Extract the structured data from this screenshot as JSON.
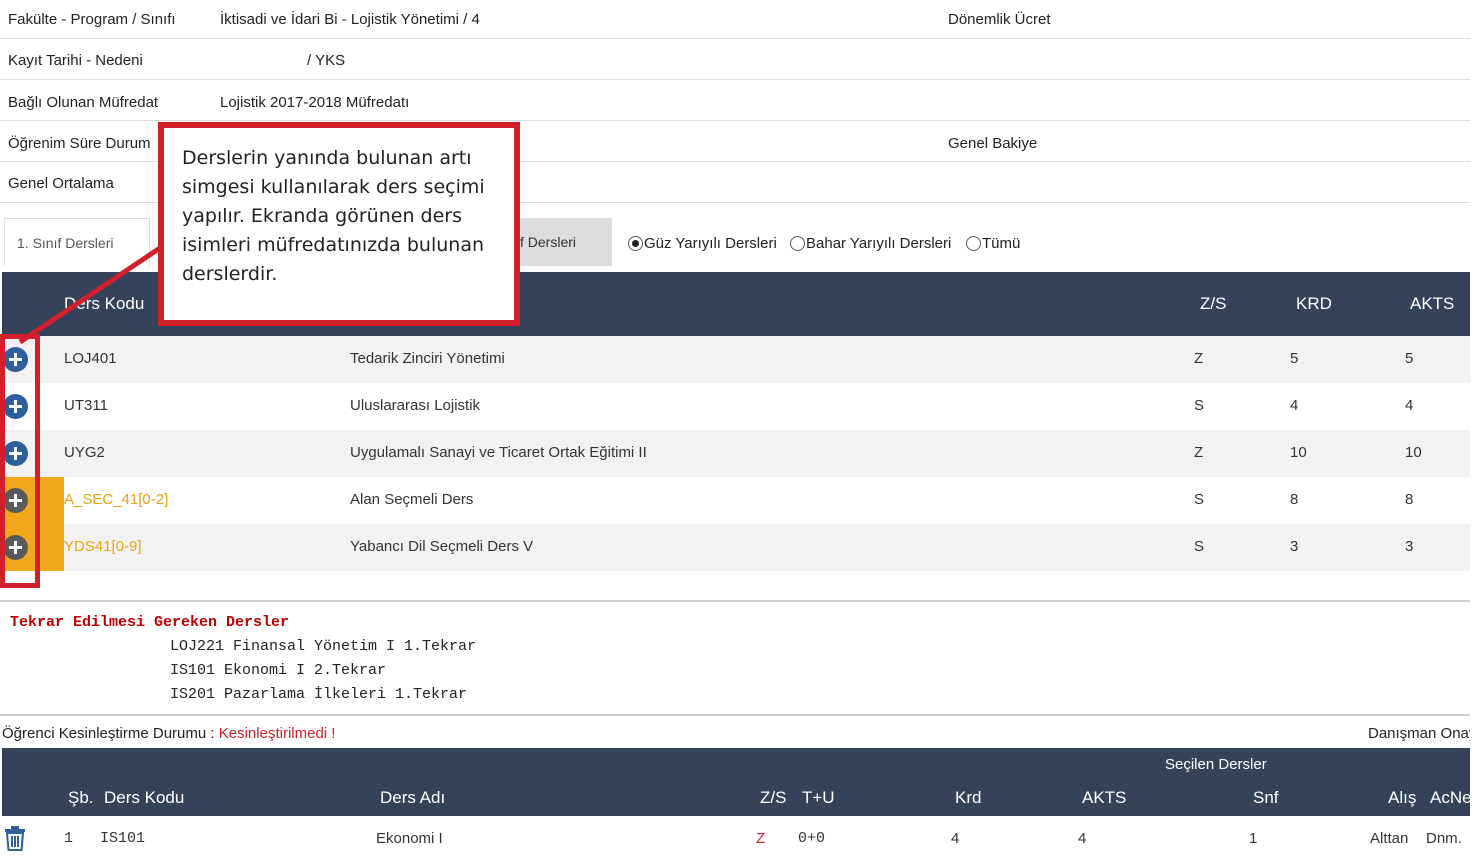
{
  "info": {
    "program_label": "Fakülte - Program / Sınıfı",
    "program_value": "İktisadi ve İdari Bi - Lojistik Yönetimi / 4",
    "fee_label": "Dönemlik Ücret",
    "registration_label": "Kayıt Tarihi - Nedeni",
    "registration_value": "/ YKS",
    "curriculum_label": "Bağlı Olunan Müfredat",
    "curriculum_value": "Lojistik 2017-2018 Müfredatı",
    "study_status_label": "Öğrenim Süre Durum",
    "balance_label": "Genel Bakiye",
    "gpa_label": "Genel Ortalama"
  },
  "tabs": {
    "first_year": "1. Sınıf Dersleri",
    "other": "f Dersleri"
  },
  "term_filter": {
    "options": [
      "Güz Yarıyılı Dersleri",
      "Bahar Yarıyılı Dersleri",
      "Tümü"
    ],
    "selected": "Güz Yarıyılı Dersleri"
  },
  "course_table": {
    "headers": {
      "code": "Ders Kodu",
      "zs": "Z/S",
      "krd": "KRD",
      "akts": "AKTS"
    },
    "rows": [
      {
        "code": "LOJ401",
        "name": "Tedarik Zinciri Yönetimi",
        "zs": "Z",
        "krd": "5",
        "akts": "5"
      },
      {
        "code": "UT311",
        "name": "Uluslararası Lojistik",
        "zs": "S",
        "krd": "4",
        "akts": "4"
      },
      {
        "code": "UYG2",
        "name": "Uygulamalı Sanayi ve Ticaret Ortak Eğitimi II",
        "zs": "Z",
        "krd": "10",
        "akts": "10"
      },
      {
        "code": "A_SEC_41[0-2]",
        "name": "Alan Seçmeli Ders",
        "zs": "S",
        "krd": "8",
        "akts": "8"
      },
      {
        "code": "YDS41[0-9]",
        "name": "Yabancı Dil Seçmeli Ders V",
        "zs": "S",
        "krd": "3",
        "akts": "3"
      }
    ]
  },
  "callout": {
    "text": "Derslerin yanında bulunan artı simgesi kullanılarak ders seçimi yapılır. Ekranda görünen ders isimleri müfredatınızda bulunan derslerdir."
  },
  "repeat": {
    "title": "Tekrar Edilmesi Gereken Dersler",
    "items": [
      "LOJ221 Finansal Yönetim I 1.Tekrar",
      "IS101 Ekonomi I 2.Tekrar",
      "IS201 Pazarlama İlkeleri 1.Tekrar"
    ]
  },
  "status": {
    "label": "Öğrenci Kesinleştirme Durumu :",
    "value": "Kesinleştirilmedi !",
    "advisor": "Danışman Onay"
  },
  "selected_table": {
    "title": "Seçilen Dersler",
    "headers": {
      "sb": "Şb.",
      "code": "Ders Kodu",
      "name": "Ders Adı",
      "zs": "Z/S",
      "tu": "T+U",
      "krd": "Krd",
      "akts": "AKTS",
      "snf": "Snf",
      "alis": "Alış",
      "acne": "AcNe"
    },
    "rows": [
      {
        "sb": "1",
        "code": "IS101",
        "name": "Ekonomi I",
        "zs": "Z",
        "tu": "0+0",
        "krd": "4",
        "akts": "4",
        "snf": "1",
        "alis": "Alttan",
        "acne": "Dnm."
      }
    ]
  },
  "colors": {
    "header_bg": "#34435a",
    "highlight_red": "#d11f2b",
    "orange": "#e8a317",
    "plus_blue": "#2d5f9a"
  }
}
